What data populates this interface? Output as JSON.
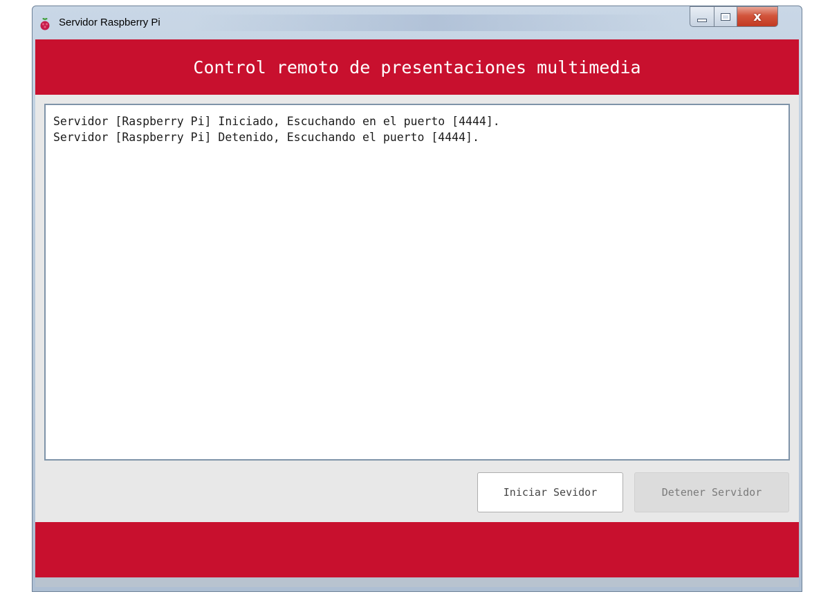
{
  "window": {
    "title": "Servidor Raspberry Pi",
    "icon": "raspberry-pi-icon",
    "controls": {
      "minimize": "minimize-icon",
      "maximize": "maximize-icon",
      "close_label": "x"
    }
  },
  "header": {
    "title": "Control remoto de presentaciones multimedia"
  },
  "log": {
    "lines": [
      "Servidor [Raspberry Pi] Iniciado, Escuchando en el puerto [4444].",
      "Servidor [Raspberry Pi] Detenido, Escuchando el puerto [4444]."
    ]
  },
  "buttons": {
    "start_label": "Iniciar Sevidor",
    "stop_label": "Detener Servidor"
  },
  "colors": {
    "accent": "#c8102e",
    "background": "#e8e8e8"
  }
}
